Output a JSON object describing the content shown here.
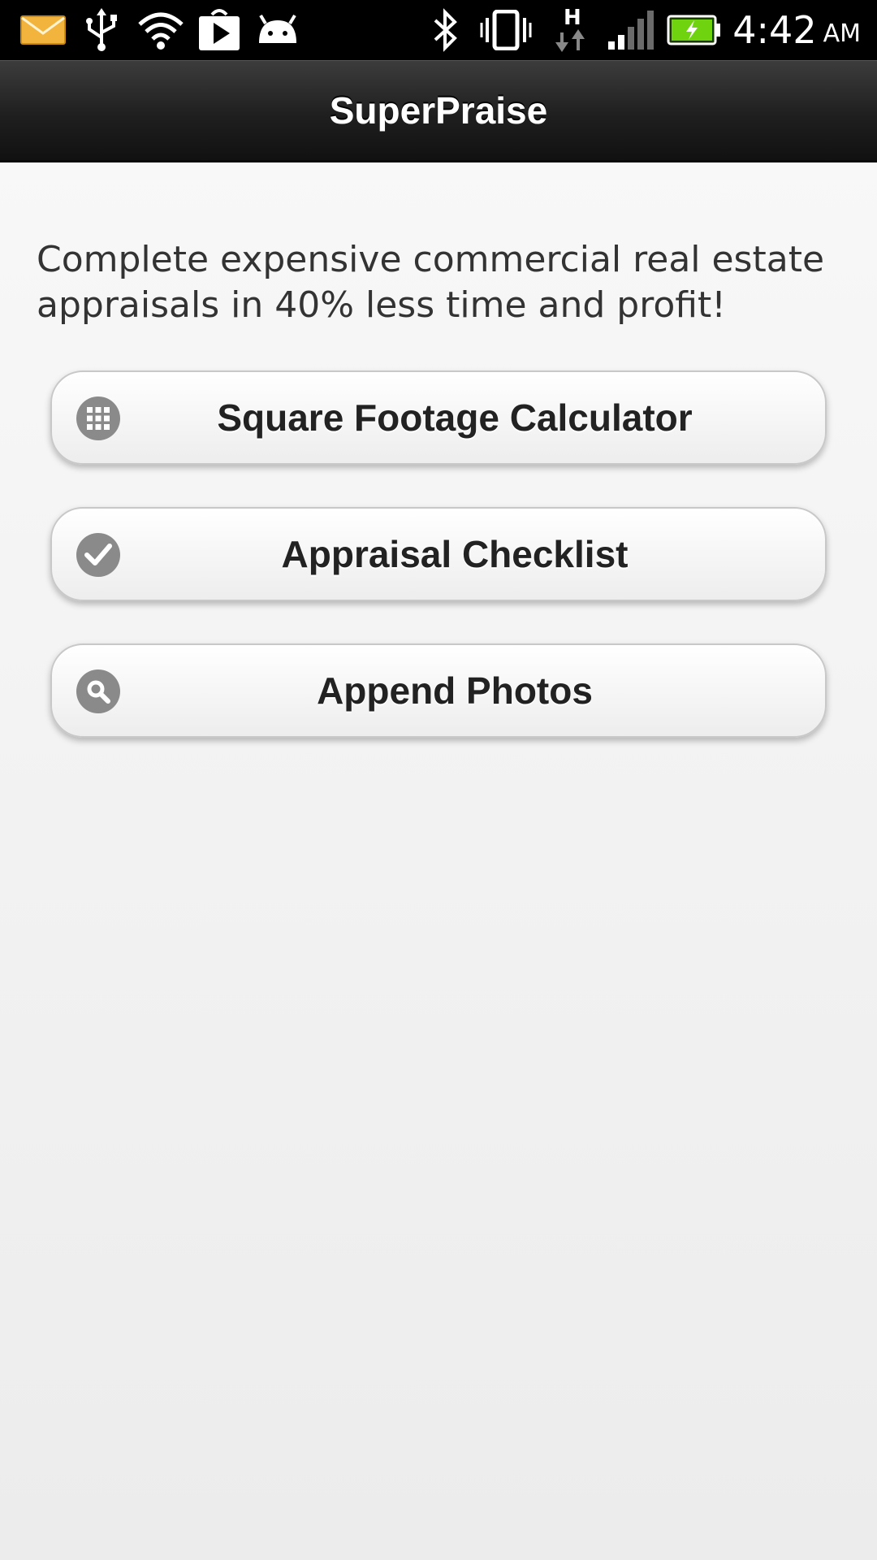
{
  "status_bar": {
    "time": "4:42",
    "ampm": "AM",
    "network_type": "H",
    "icons": [
      "email-icon",
      "usb-icon",
      "wifi-icon",
      "play-store-icon",
      "android-debug-icon",
      "bluetooth-icon",
      "vibrate-icon",
      "data-activity-icon",
      "signal-icon",
      "battery-charging-icon"
    ]
  },
  "header": {
    "title": "SuperPraise"
  },
  "main": {
    "intro_text": "Complete expensive commercial real estate appraisals in 40% less time and profit!",
    "buttons": [
      {
        "label": "Square Footage Calculator",
        "icon": "grid-icon"
      },
      {
        "label": "Appraisal Checklist",
        "icon": "check-icon"
      },
      {
        "label": "Append Photos",
        "icon": "search-icon"
      }
    ]
  },
  "colors": {
    "header_bg": "#1f1f1f",
    "battery_green": "#6fd40f",
    "icon_gray": "#8a8a8a"
  }
}
